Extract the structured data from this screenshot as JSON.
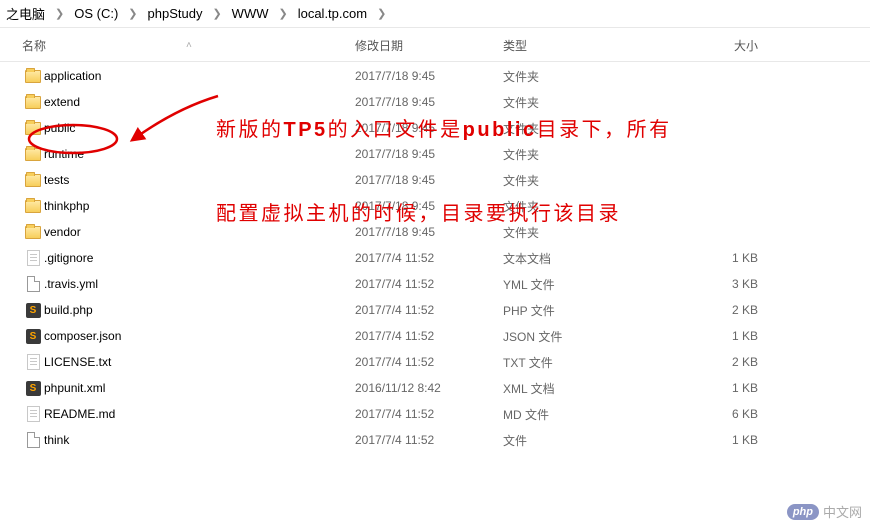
{
  "breadcrumb": [
    "之电脑",
    "OS (C:)",
    "phpStudy",
    "WWW",
    "local.tp.com"
  ],
  "columns": {
    "name": "名称",
    "date": "修改日期",
    "type": "类型",
    "size": "大小"
  },
  "rows": [
    {
      "icon": "folder",
      "name": "application",
      "date": "2017/7/18 9:45",
      "type": "文件夹",
      "size": ""
    },
    {
      "icon": "folder",
      "name": "extend",
      "date": "2017/7/18 9:45",
      "type": "文件夹",
      "size": ""
    },
    {
      "icon": "folder",
      "name": "public",
      "date": "2017/7/18 9:45",
      "type": "文件夹",
      "size": ""
    },
    {
      "icon": "folder",
      "name": "runtime",
      "date": "2017/7/18 9:45",
      "type": "文件夹",
      "size": ""
    },
    {
      "icon": "folder",
      "name": "tests",
      "date": "2017/7/18 9:45",
      "type": "文件夹",
      "size": ""
    },
    {
      "icon": "folder",
      "name": "thinkphp",
      "date": "2017/7/18 9:45",
      "type": "文件夹",
      "size": ""
    },
    {
      "icon": "folder",
      "name": "vendor",
      "date": "2017/7/18 9:45",
      "type": "文件夹",
      "size": ""
    },
    {
      "icon": "txt",
      "name": ".gitignore",
      "date": "2017/7/4 11:52",
      "type": "文本文档",
      "size": "1 KB"
    },
    {
      "icon": "file",
      "name": ".travis.yml",
      "date": "2017/7/4 11:52",
      "type": "YML 文件",
      "size": "3 KB"
    },
    {
      "icon": "sublime",
      "name": "build.php",
      "date": "2017/7/4 11:52",
      "type": "PHP 文件",
      "size": "2 KB"
    },
    {
      "icon": "sublime",
      "name": "composer.json",
      "date": "2017/7/4 11:52",
      "type": "JSON 文件",
      "size": "1 KB"
    },
    {
      "icon": "txt",
      "name": "LICENSE.txt",
      "date": "2017/7/4 11:52",
      "type": "TXT 文件",
      "size": "2 KB"
    },
    {
      "icon": "sublime",
      "name": "phpunit.xml",
      "date": "2016/11/12 8:42",
      "type": "XML 文档",
      "size": "1 KB"
    },
    {
      "icon": "txt",
      "name": "README.md",
      "date": "2017/7/4 11:52",
      "type": "MD 文件",
      "size": "6 KB"
    },
    {
      "icon": "file",
      "name": "think",
      "date": "2017/7/4 11:52",
      "type": "文件",
      "size": "1 KB"
    }
  ],
  "annotation": {
    "line1": "新版的TP5的入口文件是public目录下，所有",
    "line2": "配置虚拟主机的时候，目录要执行该目录"
  },
  "watermark": {
    "badge": "php",
    "site": "中文网"
  }
}
